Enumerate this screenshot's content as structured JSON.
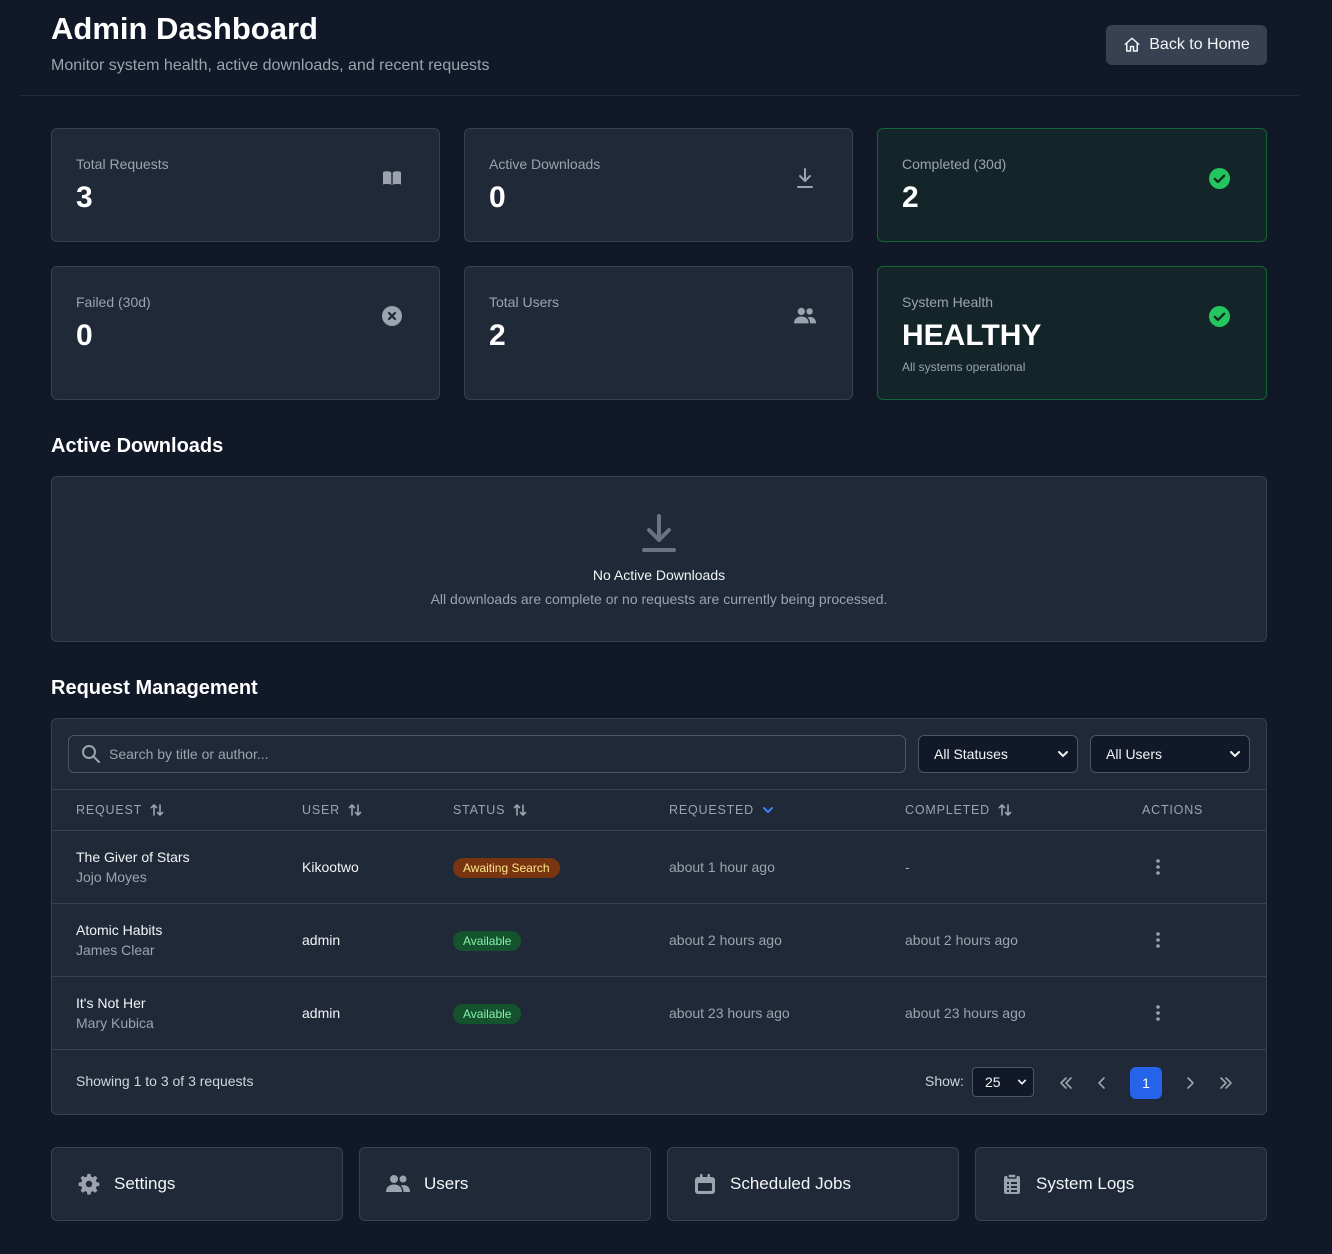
{
  "header": {
    "title": "Admin Dashboard",
    "subtitle": "Monitor system health, active downloads, and recent requests",
    "back_label": "Back to Home"
  },
  "stats": [
    {
      "label": "Total Requests",
      "value": "3",
      "icon": "book-icon"
    },
    {
      "label": "Active Downloads",
      "value": "0",
      "icon": "download-icon"
    },
    {
      "label": "Completed (30d)",
      "value": "2",
      "icon": "check-circle-icon"
    },
    {
      "label": "Failed (30d)",
      "value": "0",
      "icon": "x-circle-icon"
    },
    {
      "label": "Total Users",
      "value": "2",
      "icon": "users-icon"
    },
    {
      "label": "System Health",
      "value": "HEALTHY",
      "note": "All systems operational",
      "icon": "check-circle-icon"
    }
  ],
  "active_downloads": {
    "title": "Active Downloads",
    "empty_title": "No Active Downloads",
    "empty_sub": "All downloads are complete or no requests are currently being processed."
  },
  "requests": {
    "title": "Request Management",
    "search_placeholder": "Search by title or author...",
    "status_filter": "All Statuses",
    "user_filter": "All Users",
    "columns": [
      "REQUEST",
      "USER",
      "STATUS",
      "REQUESTED",
      "COMPLETED",
      "ACTIONS"
    ],
    "rows": [
      {
        "title": "The Giver of Stars",
        "author": "Jojo Moyes",
        "user": "Kikootwo",
        "status": "Awaiting Search",
        "requested": "about 1 hour ago",
        "completed": "-"
      },
      {
        "title": "Atomic Habits",
        "author": "James Clear",
        "user": "admin",
        "status": "Available",
        "requested": "about 2 hours ago",
        "completed": "about 2 hours ago"
      },
      {
        "title": "It's Not Her",
        "author": "Mary Kubica",
        "user": "admin",
        "status": "Available",
        "requested": "about 23 hours ago",
        "completed": "about 23 hours ago"
      }
    ],
    "showing": "Showing 1 to 3 of 3 requests",
    "show_label": "Show:",
    "page_size": "25",
    "current_page": "1"
  },
  "quick_links": [
    {
      "label": "Settings",
      "icon": "gear-icon"
    },
    {
      "label": "Users",
      "icon": "users-icon"
    },
    {
      "label": "Scheduled Jobs",
      "icon": "calendar-icon"
    },
    {
      "label": "System Logs",
      "icon": "clipboard-list-icon"
    }
  ],
  "colors": {
    "background": "#111827",
    "card": "#1f2937",
    "green_border": "#166534",
    "green_accent": "#22c55e",
    "accent_blue": "#2563eb"
  }
}
